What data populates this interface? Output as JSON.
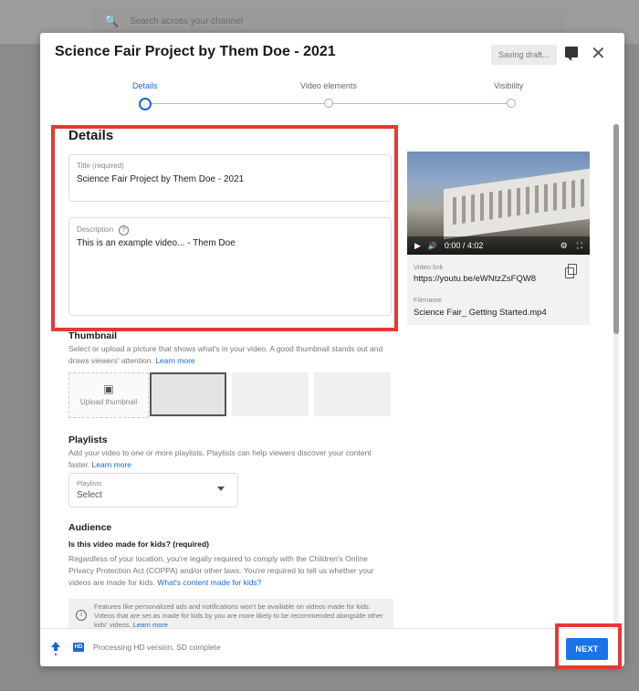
{
  "search": {
    "placeholder": "Search across your channel"
  },
  "dialog": {
    "title": "Science Fair Project by Them Doe - 2021",
    "saving_label": "Saving draft...",
    "close_glyph": "✕"
  },
  "steps": [
    {
      "label": "Details",
      "active": true
    },
    {
      "label": "Video elements",
      "active": false
    },
    {
      "label": "Visibility",
      "active": false
    }
  ],
  "details": {
    "heading": "Details",
    "title_label": "Title (required)",
    "title_value": "Science Fair Project by Them Doe -  2021",
    "description_label": "Description",
    "description_help_glyph": "?",
    "description_value": "This is an example video... - Them Doe"
  },
  "thumbnail": {
    "heading": "Thumbnail",
    "help": "Select or upload a picture that shows what's in your video. A good thumbnail stands out and draws viewers' attention.",
    "learn_more": "Learn more",
    "upload_label": "Upload thumbnail",
    "upload_icon": "image-add-icon"
  },
  "playlists": {
    "heading": "Playlists",
    "help": "Add your video to one or more playlists. Playlists can help viewers discover your content faster.",
    "learn_more": "Learn more",
    "dropdown_label": "Playlists",
    "dropdown_value": "Select"
  },
  "audience": {
    "heading": "Audience",
    "question": "Is this video made for kids? (required)",
    "help": "Regardless of your location, you're legally required to comply with the Children's Online Privacy Protection Act (COPPA) and/or other laws. You're required to tell us whether your videos are made for kids.",
    "link": "What's content made for kids?",
    "notice": "Features like personalized ads and notifications won't be available on videos made for kids. Videos that are set as made for kids by you are more likely to be recommended alongside other kids' videos.",
    "notice_link": "Learn more",
    "info_glyph": "i"
  },
  "preview": {
    "time": "0:00 / 4:02",
    "play_glyph": "▶",
    "volume_glyph": "🔊",
    "settings_glyph": "⚙",
    "fullscreen_glyph": "⛶",
    "video_link_label": "Video link",
    "video_link": "https://youtu.be/eWNtzZsFQW8",
    "filename_label": "Filename",
    "filename": "Science Fair_ Getting Started.mp4"
  },
  "footer": {
    "hd_badge": "HD",
    "processing": "Processing HD version, SD complete",
    "next_label": "NEXT"
  },
  "colors": {
    "accent": "#1a73e8",
    "highlight_box": "#e53935"
  }
}
